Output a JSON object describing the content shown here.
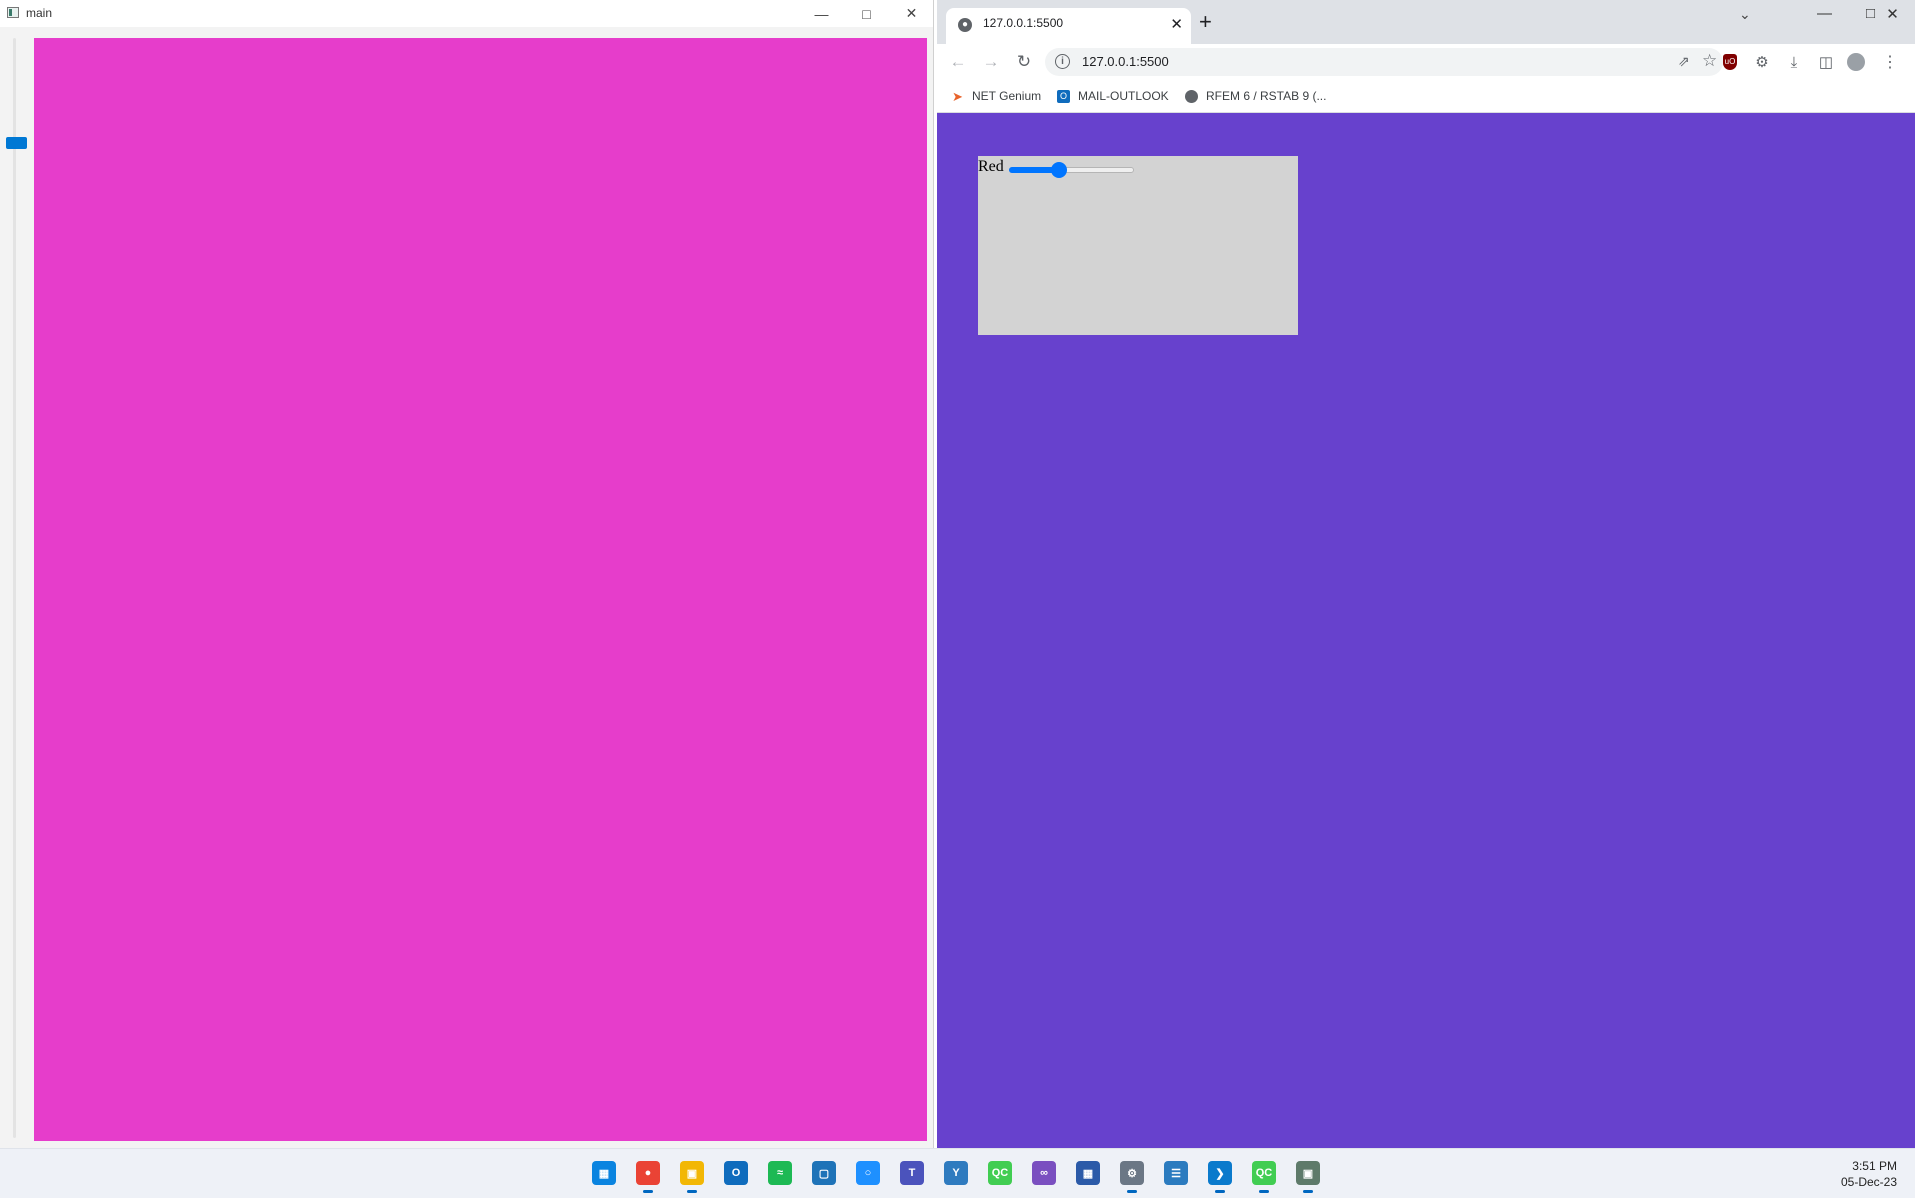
{
  "app_window": {
    "title": "main",
    "minimize_icon": "minimize-icon",
    "maximize_icon": "maximize-icon",
    "close_icon": "close-icon",
    "slider_level": 0.09,
    "canvas_color": "#e63dcb"
  },
  "browser": {
    "tab_title": "127.0.0.1:5500",
    "url": "127.0.0.1:5500",
    "new_tab_glyph": "+",
    "bookmarks": [
      {
        "label": "NET Genium",
        "icon": "net-genium-icon"
      },
      {
        "label": "MAIL-OUTLOOK",
        "icon": "outlook-icon"
      },
      {
        "label": "RFEM 6 / RSTAB 9 (...",
        "icon": "globe-icon"
      }
    ],
    "page_background": "#6741cd"
  },
  "page": {
    "red_label": "Red",
    "red_slider_value": 0.4,
    "panel_color": "#d3d3d3"
  },
  "taskbar": {
    "apps": [
      {
        "name": "start-icon"
      },
      {
        "name": "chrome-icon"
      },
      {
        "name": "file-explorer-icon"
      },
      {
        "name": "outlook-icon"
      },
      {
        "name": "spotify-icon"
      },
      {
        "name": "app-icon"
      },
      {
        "name": "app-icon"
      },
      {
        "name": "teams-icon"
      },
      {
        "name": "app-icon"
      },
      {
        "name": "qt-creator-icon"
      },
      {
        "name": "visual-studio-icon"
      },
      {
        "name": "app-icon"
      },
      {
        "name": "settings-icon"
      },
      {
        "name": "notepad-icon"
      },
      {
        "name": "vscode-icon"
      },
      {
        "name": "qt-creator-icon"
      },
      {
        "name": "app-icon"
      }
    ],
    "time": "3:51 PM",
    "date": "05-Dec-23"
  }
}
